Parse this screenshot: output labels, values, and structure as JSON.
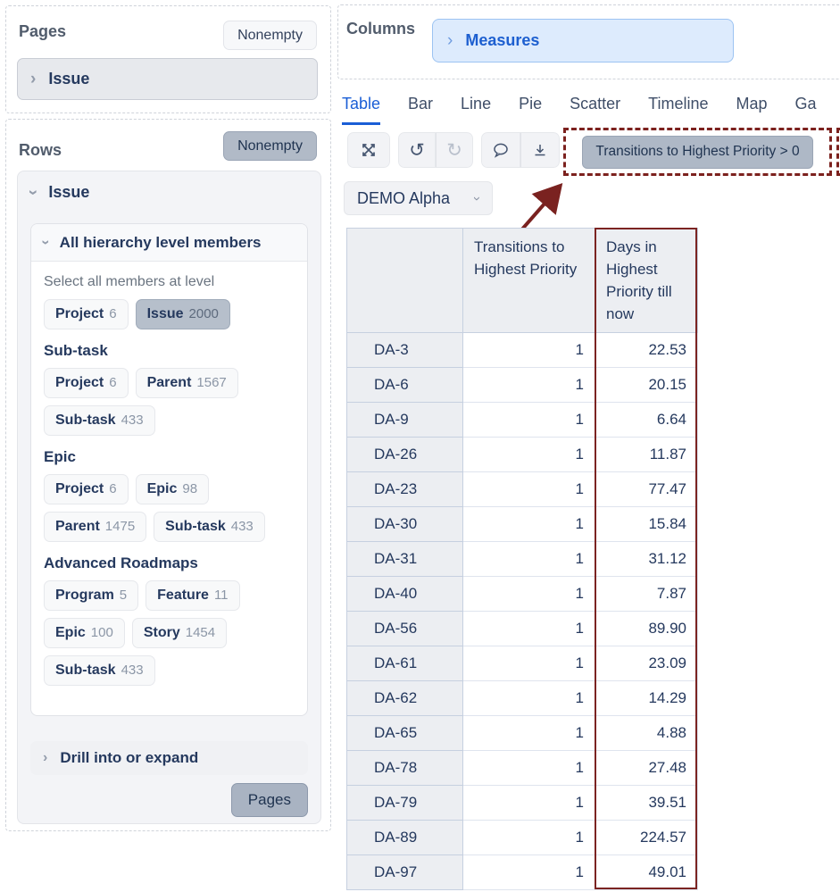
{
  "accent_colors": {
    "annotation_maroon": "#7c211e",
    "link_blue": "#1a5ed6",
    "measures_bg": "#ddebfd",
    "selected_gray": "#b1bac7"
  },
  "pages_panel": {
    "title": "Pages",
    "nonempty_label": "Nonempty",
    "dimension": "Issue"
  },
  "rows_panel": {
    "title": "Rows",
    "nonempty_label": "Nonempty",
    "dimension": "Issue",
    "hierarchy": {
      "title": "All hierarchy level members",
      "intro": "Select all members at level",
      "groups": [
        {
          "heading": "",
          "badges": [
            {
              "label": "Project",
              "count": "6",
              "selected": false
            },
            {
              "label": "Issue",
              "count": "2000",
              "selected": true
            }
          ]
        },
        {
          "heading": "Sub-task",
          "badges": [
            {
              "label": "Project",
              "count": "6",
              "selected": false
            },
            {
              "label": "Parent",
              "count": "1567",
              "selected": false
            },
            {
              "label": "Sub-task",
              "count": "433",
              "selected": false
            }
          ]
        },
        {
          "heading": "Epic",
          "badges": [
            {
              "label": "Project",
              "count": "6",
              "selected": false
            },
            {
              "label": "Epic",
              "count": "98",
              "selected": false
            },
            {
              "label": "Parent",
              "count": "1475",
              "selected": false
            },
            {
              "label": "Sub-task",
              "count": "433",
              "selected": false
            }
          ]
        },
        {
          "heading": "Advanced Roadmaps",
          "badges": [
            {
              "label": "Program",
              "count": "5",
              "selected": false
            },
            {
              "label": "Feature",
              "count": "11",
              "selected": false
            },
            {
              "label": "Epic",
              "count": "100",
              "selected": false
            },
            {
              "label": "Story",
              "count": "1454",
              "selected": false
            },
            {
              "label": "Sub-task",
              "count": "433",
              "selected": false
            }
          ]
        }
      ]
    },
    "drill_label": "Drill into or expand",
    "pages_button_label": "Pages"
  },
  "columns_panel": {
    "title": "Columns",
    "measures_label": "Measures"
  },
  "tabs": {
    "items": [
      "Table",
      "Bar",
      "Line",
      "Pie",
      "Scatter",
      "Timeline",
      "Map",
      "Ga"
    ],
    "active": "Table"
  },
  "toolbar": {
    "icons": [
      "expand-icon",
      "undo-icon",
      "redo-icon",
      "comment-icon",
      "download-icon"
    ],
    "undo_glyph": "↺",
    "redo_glyph": "↻",
    "filter_button_label": "Transitions to Highest Priority > 0"
  },
  "report_dropdown": {
    "label": "DEMO Alpha"
  },
  "table": {
    "headers": [
      "",
      "Transitions to Highest Priority",
      "Days in Highest Priority till now"
    ],
    "rows": [
      [
        "DA-3",
        "1",
        "22.53"
      ],
      [
        "DA-6",
        "1",
        "20.15"
      ],
      [
        "DA-9",
        "1",
        "6.64"
      ],
      [
        "DA-26",
        "1",
        "11.87"
      ],
      [
        "DA-23",
        "1",
        "77.47"
      ],
      [
        "DA-30",
        "1",
        "15.84"
      ],
      [
        "DA-31",
        "1",
        "31.12"
      ],
      [
        "DA-40",
        "1",
        "7.87"
      ],
      [
        "DA-56",
        "1",
        "89.90"
      ],
      [
        "DA-61",
        "1",
        "23.09"
      ],
      [
        "DA-62",
        "1",
        "14.29"
      ],
      [
        "DA-65",
        "1",
        "4.88"
      ],
      [
        "DA-78",
        "1",
        "27.48"
      ],
      [
        "DA-79",
        "1",
        "39.51"
      ],
      [
        "DA-89",
        "1",
        "224.57"
      ],
      [
        "DA-97",
        "1",
        "49.01"
      ]
    ]
  }
}
